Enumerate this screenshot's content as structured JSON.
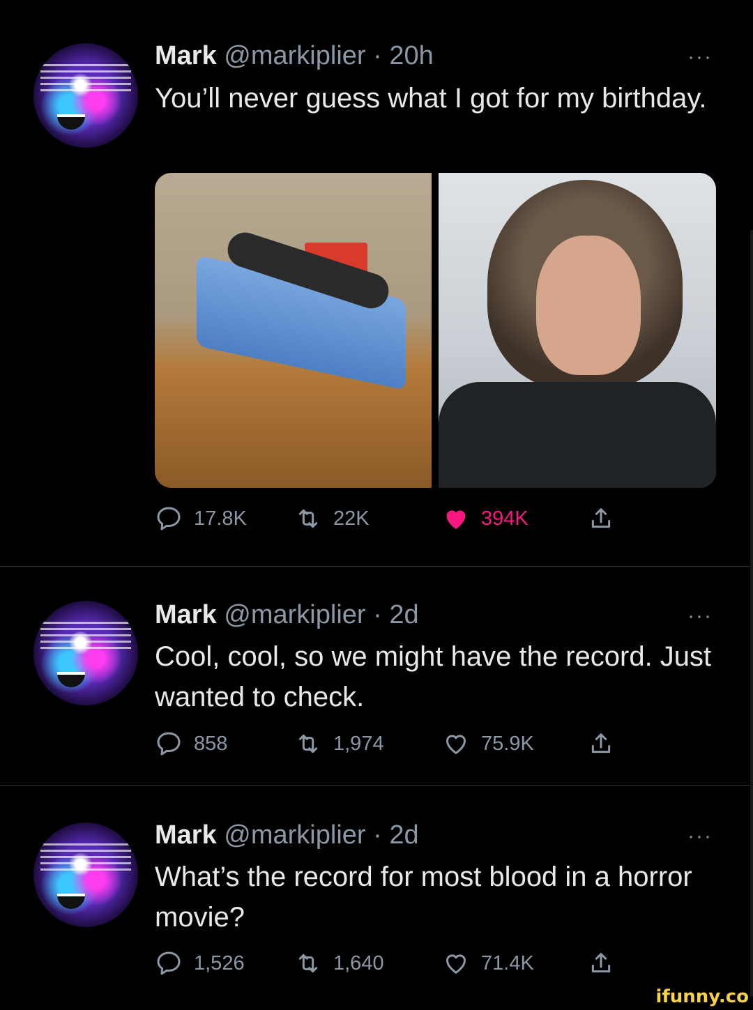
{
  "tweets": [
    {
      "name": "Mark",
      "handle": "@markiplier",
      "separator": "·",
      "time": "20h",
      "text": "You’ll never guess what I got for my birthday.",
      "more": "···",
      "media": [
        "hospital-bed-photo",
        "selfie-photo"
      ],
      "actions": {
        "replies": "17.8K",
        "retweets": "22K",
        "likes": "394K",
        "liked": true
      }
    },
    {
      "name": "Mark",
      "handle": "@markiplier",
      "separator": "·",
      "time": "2d",
      "text": "Cool, cool, so we might have the record. Just wanted to check.",
      "more": "···",
      "actions": {
        "replies": "858",
        "retweets": "1,974",
        "likes": "75.9K",
        "liked": false
      }
    },
    {
      "name": "Mark",
      "handle": "@markiplier",
      "separator": "·",
      "time": "2d",
      "text": "What’s the record for most blood in a horror movie?",
      "more": "···",
      "actions": {
        "replies": "1,526",
        "retweets": "1,640",
        "likes": "71.4K",
        "liked": false
      }
    }
  ],
  "icons": {
    "reply": "speech-bubble-icon",
    "retweet": "retweet-arrows-icon",
    "like": "heart-icon",
    "share": "share-upload-icon"
  },
  "colors": {
    "background": "#000000",
    "muted": "#8b98a5",
    "like_active": "#f91880"
  },
  "watermark": "ifunny.co"
}
